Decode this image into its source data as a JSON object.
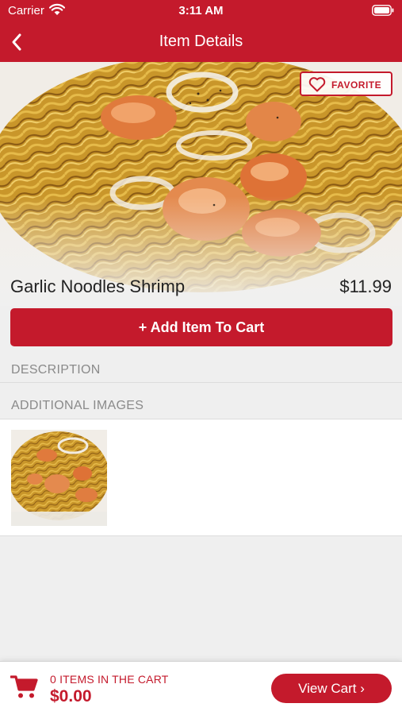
{
  "status_bar": {
    "carrier": "Carrier",
    "time": "3:11 AM"
  },
  "nav": {
    "title": "Item Details"
  },
  "item": {
    "favorite_label": "FAVORITE",
    "name": "Garlic Noodles Shrimp",
    "price": "$11.99"
  },
  "actions": {
    "add_to_cart_label": "Add Item To Cart"
  },
  "sections": {
    "description_header": "DESCRIPTION",
    "additional_images_header": "ADDITIONAL IMAGES"
  },
  "cart": {
    "items_count_text": "0 ITEMS IN THE CART",
    "total": "$0.00",
    "view_cart_label": "View Cart ›"
  },
  "colors": {
    "brand": "#c41a2c",
    "background": "#efefef"
  }
}
